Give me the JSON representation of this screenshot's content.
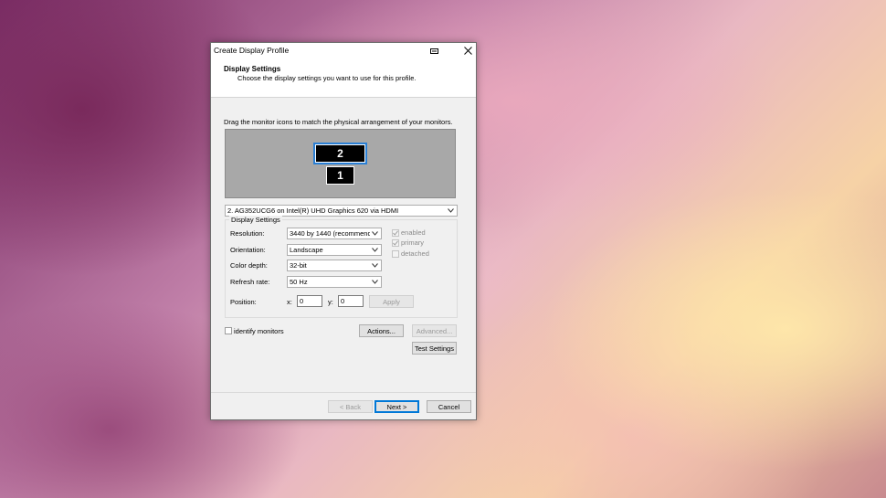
{
  "window": {
    "title": "Create Display Profile"
  },
  "header": {
    "title": "Display Settings",
    "subtitle": "Choose the display settings you want to use for this profile."
  },
  "instructions": "Drag the monitor icons to match the physical arrangement of your monitors.",
  "monitors": [
    {
      "label": "2",
      "selected": true
    },
    {
      "label": "1",
      "selected": false
    }
  ],
  "monitor_select": "2. AG352UCG6 on Intel(R) UHD Graphics 620 via HDMI",
  "display_settings": {
    "group_title": "Display Settings",
    "resolution": {
      "label": "Resolution:",
      "value": "3440 by 1440  (recommend"
    },
    "orientation": {
      "label": "Orientation:",
      "value": "Landscape"
    },
    "color_depth": {
      "label": "Color depth:",
      "value": "32-bit"
    },
    "refresh_rate": {
      "label": "Refresh rate:",
      "value": "50 Hz"
    },
    "position": {
      "label": "Position:",
      "x_label": "x:",
      "x_value": "0",
      "y_label": "y:",
      "y_value": "0"
    },
    "apply": "Apply",
    "checks": {
      "enabled": "enabled",
      "primary": "primary",
      "detached": "detached"
    }
  },
  "identify": "identify monitors",
  "actions": "Actions...",
  "advanced": "Advanced...",
  "test_settings": "Test Settings",
  "footer": {
    "back": "< Back",
    "next": "Next >",
    "cancel": "Cancel"
  },
  "colors": {
    "accent": "#0078d7",
    "monitor_area": "#a8a8a8"
  }
}
